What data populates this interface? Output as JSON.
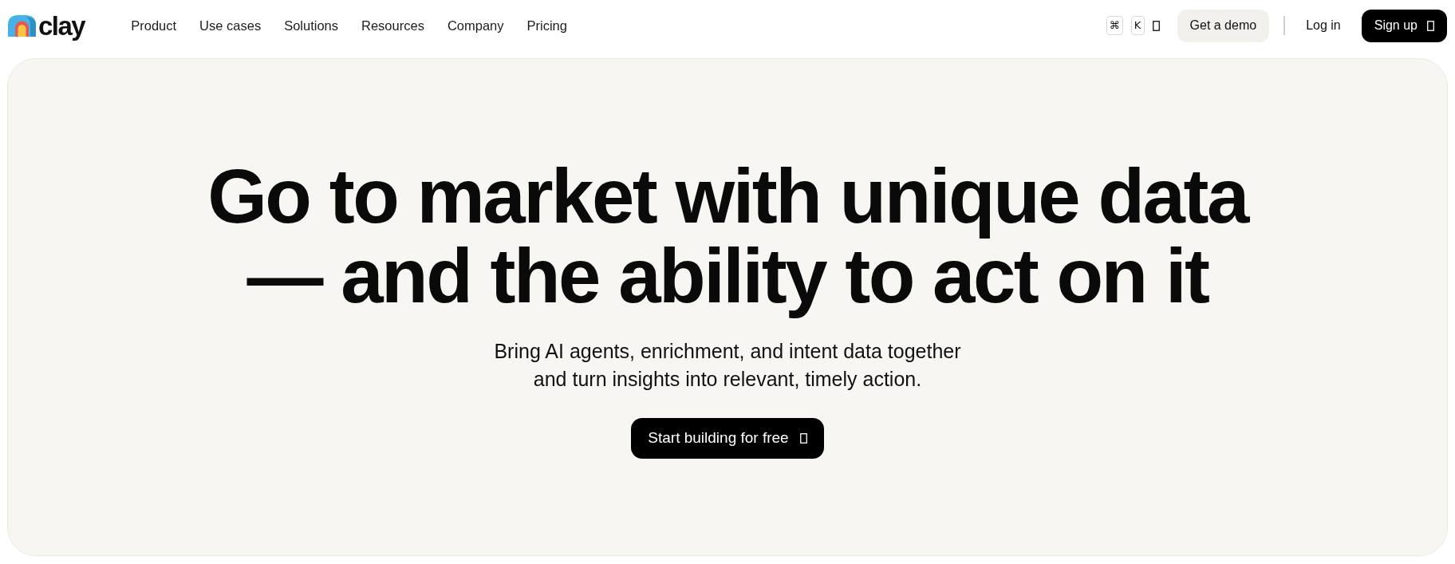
{
  "header": {
    "logo": {
      "text": "clay"
    },
    "nav": [
      "Product",
      "Use cases",
      "Solutions",
      "Resources",
      "Company",
      "Pricing"
    ],
    "shortcut_keys": [
      "⌘",
      "K"
    ],
    "buttons": [
      {
        "label": "Get a demo",
        "kind": "secondary"
      },
      {
        "label": "Log in",
        "kind": "link"
      },
      {
        "label": "Sign up",
        "kind": "primary"
      }
    ]
  },
  "hero": {
    "heading_lines": [
      "Go to market with unique data",
      "— and the ability to act on it"
    ],
    "subtitle_lines": [
      "Bring AI agents, enrichment, and intent data together",
      "and turn insights into relevant, timely action."
    ],
    "cta": {
      "label": "Start building for free"
    }
  }
}
